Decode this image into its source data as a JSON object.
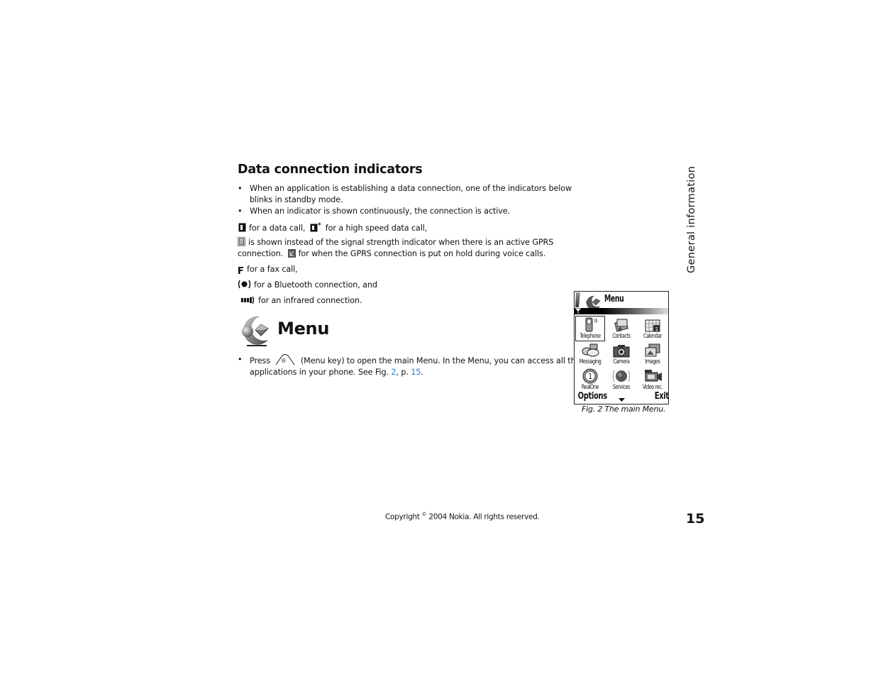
{
  "section": {
    "heading": "Data connection indicators",
    "bullets": [
      "When an application is establishing a data connection, one of the indicators below",
      "blinks in standby mode.",
      "When an indicator is shown continuously, the connection is active."
    ],
    "indicators": {
      "data_call": "for a data call,",
      "high_speed": "for a high speed data call,",
      "gprs_line1": "is shown instead of the signal strength indicator when there is an active GPRS",
      "gprs_line2_a": "connection.",
      "gprs_line2_b": "for when the GPRS connection is put on hold during voice calls.",
      "fax": "for a fax call,",
      "bluetooth": "for a Bluetooth connection, and",
      "infrared": "for an infrared connection."
    }
  },
  "menu_section": {
    "heading": "Menu",
    "press": "Press",
    "line1_rest": "(Menu key) to open the main Menu. In the Menu, you can access all the",
    "line2_a": "applications in your phone. See Fig.",
    "fig_link": "2",
    "line2_b": ", p.",
    "page_link": "15",
    "line2_end": "."
  },
  "phone_screen": {
    "title": "Menu",
    "items": [
      {
        "label": "Telephone",
        "icon": "telephone-icon",
        "selected": true
      },
      {
        "label": "Contacts",
        "icon": "contacts-icon"
      },
      {
        "label": "Calendar",
        "icon": "calendar-icon"
      },
      {
        "label": "Messaging",
        "icon": "messaging-icon"
      },
      {
        "label": "Camera",
        "icon": "camera-icon"
      },
      {
        "label": "Images",
        "icon": "images-icon"
      },
      {
        "label": "RealOne",
        "icon": "realone-icon"
      },
      {
        "label": "Services",
        "icon": "services-icon"
      },
      {
        "label": "Video rec.",
        "icon": "video-recorder-icon"
      }
    ],
    "left_softkey": "Options",
    "right_softkey": "Exit",
    "caption": "Fig. 2 The main Menu."
  },
  "side_tab": "General information",
  "footer": {
    "copyright_a": "Copyright",
    "copyright_symbol": "©",
    "copyright_b": "2004 Nokia. All rights reserved.",
    "page_number": "15"
  },
  "colors": {
    "link": "#2b7bd6",
    "text": "#111111"
  }
}
